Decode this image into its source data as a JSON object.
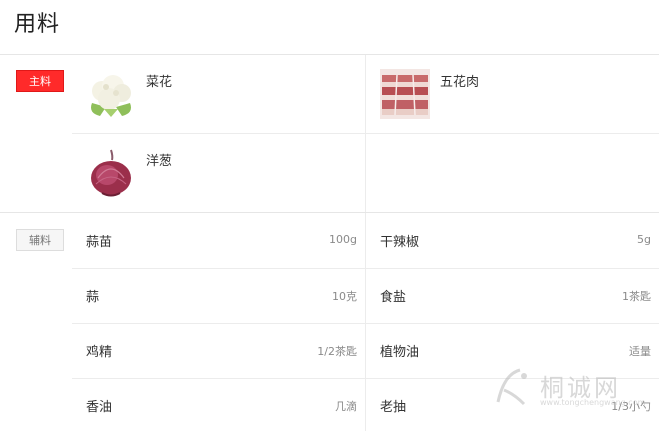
{
  "page": {
    "title": "用料"
  },
  "main": {
    "badge": "主料",
    "items": [
      {
        "name": "菜花",
        "image": "cauliflower-image"
      },
      {
        "name": "五花肉",
        "image": "pork-belly-image"
      },
      {
        "name": "洋葱",
        "image": "onion-image"
      }
    ]
  },
  "aux": {
    "badge": "辅料",
    "items": [
      {
        "name": "蒜苗",
        "qty": "100g"
      },
      {
        "name": "干辣椒",
        "qty": "5g"
      },
      {
        "name": "蒜",
        "qty": "10克"
      },
      {
        "name": "食盐",
        "qty": "1茶匙"
      },
      {
        "name": "鸡精",
        "qty": "1/2茶匙"
      },
      {
        "name": "植物油",
        "qty": "适量"
      },
      {
        "name": "香油",
        "qty": "几滴"
      },
      {
        "name": "老抽",
        "qty": "1/3小勺"
      }
    ]
  },
  "watermark": {
    "text": "桐诚网",
    "url": "www.tongchengwang.com"
  },
  "colors": {
    "main_badge": "#ff2a2a",
    "aux_badge": "#f6f6f6",
    "divider": "#e6e6e6"
  }
}
